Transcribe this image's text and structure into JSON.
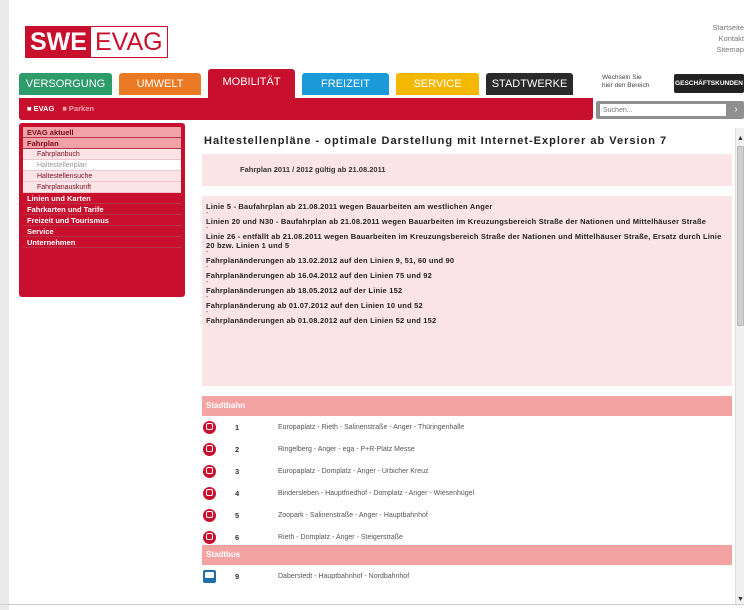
{
  "toplinks": [
    "Startseite",
    "Kontakt",
    "Sitemap"
  ],
  "logo": {
    "swe": "SWE",
    "evag": "EVAG"
  },
  "nav": [
    {
      "label": "VERSORGUNG",
      "color": "#2d9b6a",
      "w": 93
    },
    {
      "label": "UMWELT",
      "color": "#ea7a24",
      "w": 82
    },
    {
      "label": "MOBILITÄT",
      "color": "#c8102e",
      "w": 87
    },
    {
      "label": "FREIZEIT",
      "color": "#1a9bd7",
      "w": 87
    },
    {
      "label": "SERVICE",
      "color": "#f5b800",
      "w": 83
    },
    {
      "label": "STADTWERKE",
      "color": "#2a2a2a",
      "w": 87
    }
  ],
  "switch": {
    "line1": "Wechseln Sie",
    "line2": "hier den Bereich"
  },
  "geschaeftskunden": "GESCHÄFTSKUNDEN",
  "breadcrumb": {
    "evag": "■ EVAG",
    "parken": "■ Parken"
  },
  "search": {
    "placeholder": "Suchen...",
    "button": "›"
  },
  "sidebar": [
    {
      "label": "EVAG aktuell",
      "type": "first"
    },
    {
      "label": "Fahrplan",
      "type": "open"
    },
    {
      "label": "Fahrplanbuch",
      "type": "sub"
    },
    {
      "label": "Haltestellenplan",
      "type": "cur"
    },
    {
      "label": "Haltestellensuche",
      "type": "sub"
    },
    {
      "label": "Fahrplanauskunft",
      "type": "sub"
    },
    {
      "label": "Linien und Karten",
      "type": "item"
    },
    {
      "label": "Fahrkarten und Tarife",
      "type": "item"
    },
    {
      "label": "Freizeit und Tourismus",
      "type": "item"
    },
    {
      "label": "Service",
      "type": "item"
    },
    {
      "label": "Unternehmen",
      "type": "item"
    }
  ],
  "content": {
    "title": "Haltestellenpläne - optimale Darstellung mit Internet-Explorer ab Version 7",
    "fahrplan": "Fahrplan 2011 / 2012 gültig ab 21.08.2011",
    "notes": [
      "Linie 5 - Baufahrplan ab 21.08.2011 wegen Bauarbeiten am westlichen Anger",
      "Linien 20 und N30 - Baufahrplan ab 21.08.2011 wegen Bauarbeiten im Kreuzungsbereich Straße der Nationen und Mittelhäuser Straße",
      "Linie 26 - entfällt ab 21.08.2011 wegen Bauarbeiten im Kreuzungsbereich Straße der Nationen und Mittelhäuser Straße, Ersatz durch Linie 20 bzw. Linien 1 und 5",
      "Fahrplanänderungen ab 13.02.2012 auf den Linien 9, 51, 60 und 90",
      "Fahrplanänderungen ab 16.04.2012 auf den Linien 75 und 92",
      "Fahrplanänderungen ab 18.05.2012 auf der Linie 152",
      "Fahrplanänderung ab 01.07.2012 auf den Linien 10 und 52",
      "Fahrplanänderungen ab 01.08.2012 auf den Linien 52 und 152"
    ],
    "dash": "-",
    "stadtbahn": "Stadtbahn",
    "tram": [
      {
        "num": "1",
        "route": "Europaplatz - Rieth - Salinenstraße - Anger - Thüringenhalle"
      },
      {
        "num": "2",
        "route": "Ringelberg - Anger - ega - P+R-Platz Messe"
      },
      {
        "num": "3",
        "route": "Europaplatz - Domplatz - Anger - Urbicher Kreuz"
      },
      {
        "num": "4",
        "route": "Bindersleben - Hauptfriedhof - Domplatz - Anger - Wiesenhügel"
      },
      {
        "num": "5",
        "route": "Zoopark - Salinenstraße - Anger - Hauptbahnhof"
      },
      {
        "num": "6",
        "route": "Rieth - Domplatz - Anger - Steigerstraße"
      }
    ],
    "stadtbus": "Stadtbus",
    "bus": [
      {
        "num": "9",
        "route": "Daberstedt - Hauptbahnhof - Nordbahnhof"
      }
    ]
  }
}
